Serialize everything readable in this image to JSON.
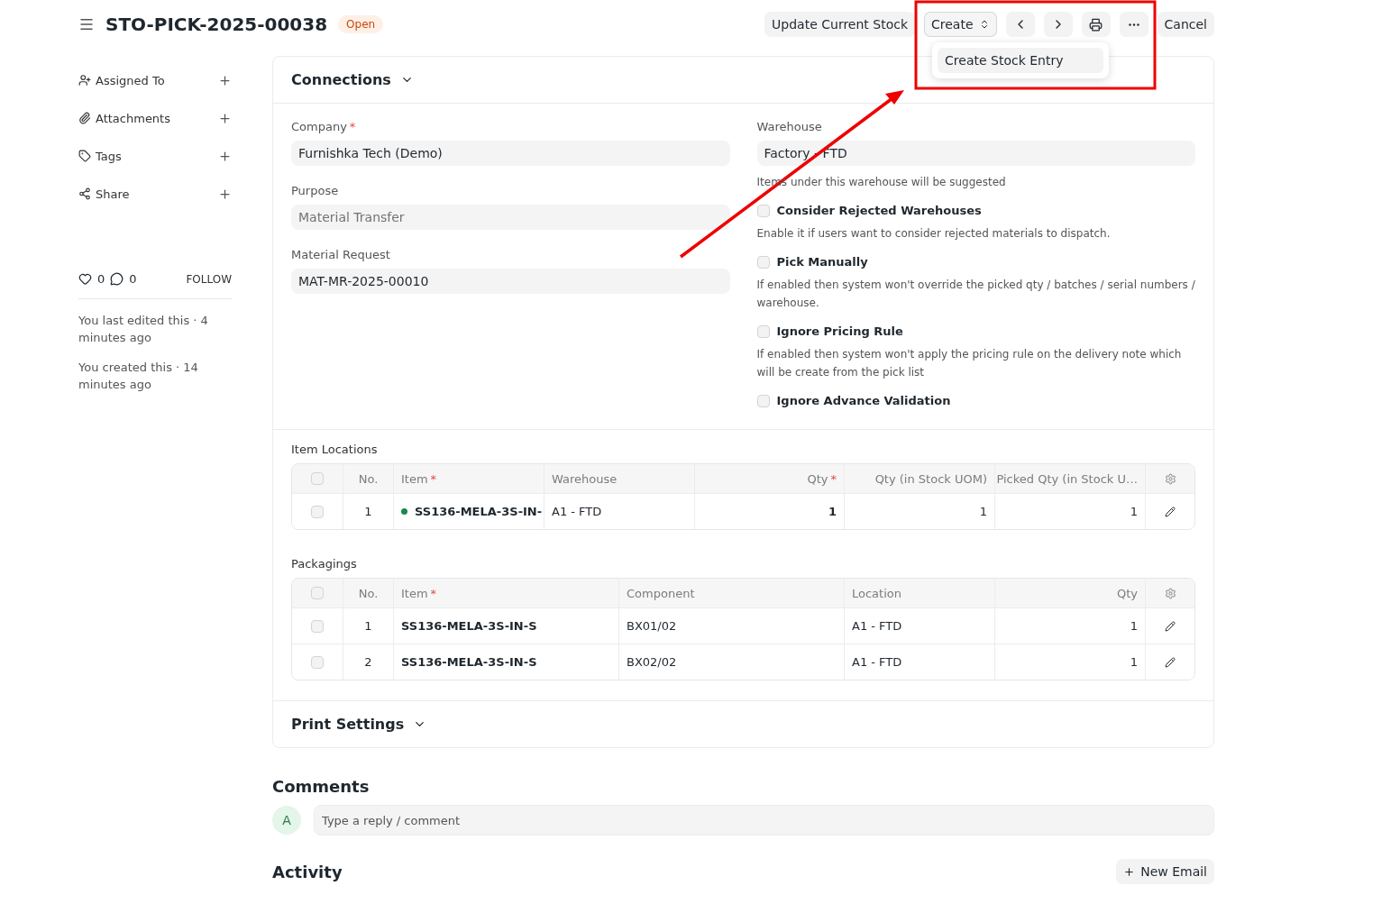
{
  "header": {
    "title": "STO-PICK-2025-00038",
    "status": "Open"
  },
  "actions": [
    {
      "kind": "text",
      "label": "Update Current Stock"
    },
    {
      "kind": "dropdown",
      "label": "Create"
    },
    {
      "kind": "prev"
    },
    {
      "kind": "next"
    },
    {
      "kind": "print"
    },
    {
      "kind": "more"
    },
    {
      "kind": "text",
      "label": "Cancel"
    }
  ],
  "dropdown": {
    "items": [
      "Create Stock Entry"
    ]
  },
  "sidebar": {
    "items": [
      {
        "kind": "assign",
        "label": "Assigned To"
      },
      {
        "kind": "attach",
        "label": "Attachments"
      },
      {
        "kind": "tag",
        "label": "Tags"
      },
      {
        "kind": "share",
        "label": "Share"
      }
    ],
    "likes": "0",
    "comments": "0",
    "follow": "FOLLOW",
    "timeline": [
      "You last edited this · 4 minutes ago",
      "You created this · 14 minutes ago"
    ]
  },
  "connections": "Connections",
  "left_fields": [
    {
      "label": "Company",
      "required_mark": "*",
      "value": "Furnishka Tech (Demo)",
      "readonly": false
    },
    {
      "label": "Purpose",
      "value": "Material Transfer",
      "readonly": true
    },
    {
      "label": "Material Request",
      "value": "MAT-MR-2025-00010",
      "readonly": false
    }
  ],
  "warehouse": {
    "label": "Warehouse",
    "value": "Factory - FTD",
    "description": "Items under this warehouse will be suggested"
  },
  "checks": [
    {
      "label": "Consider Rejected Warehouses",
      "checked": false,
      "description": "Enable it if users want to consider rejected materials to dispatch."
    },
    {
      "label": "Pick Manually",
      "checked": false,
      "description": "If enabled then system won't override the picked qty / batches / serial numbers / warehouse."
    },
    {
      "label": "Ignore Pricing Rule",
      "checked": false,
      "description": "If enabled then system won't apply the pricing rule on the delivery note which will be create from the pick list"
    },
    {
      "label": "Ignore Advance Validation",
      "checked": false
    }
  ],
  "tables": [
    {
      "title": "Item Locations",
      "select_all": false,
      "columns": [
        {
          "label": "No.",
          "kind": "index"
        },
        {
          "label": "Item",
          "required_mark": "*",
          "kind": "link"
        },
        {
          "label": "Warehouse",
          "kind": "text"
        },
        {
          "label": "Qty",
          "required_mark": "*",
          "kind": "bold_number"
        },
        {
          "label": "Qty (in Stock UOM)",
          "kind": "number"
        },
        {
          "label": "Picked Qty (in Stock U…",
          "kind": "number"
        }
      ],
      "rows": [
        {
          "checked": false,
          "color": "#178a4f",
          "cells": [
            "1",
            "SS136-MELA-3S-IN-",
            "A1 - FTD",
            "1",
            "1",
            "1"
          ]
        }
      ]
    },
    {
      "title": "Packagings",
      "select_all": false,
      "columns": [
        {
          "label": "No.",
          "kind": "index"
        },
        {
          "label": "Item",
          "required_mark": "*",
          "kind": "link"
        },
        {
          "label": "Component",
          "kind": "text"
        },
        {
          "label": "Location",
          "kind": "text"
        },
        {
          "label": "Qty",
          "kind": "number"
        }
      ],
      "rows": [
        {
          "checked": false,
          "cells": [
            "1",
            "SS136-MELA-3S-IN-S",
            "BX01/02",
            "A1 - FTD",
            "1"
          ]
        },
        {
          "checked": false,
          "cells": [
            "2",
            "SS136-MELA-3S-IN-S",
            "BX02/02",
            "A1 - FTD",
            "1"
          ]
        }
      ]
    }
  ],
  "print_settings": "Print Settings",
  "comments": {
    "title": "Comments",
    "avatar": "A",
    "placeholder": "Type a reply / comment"
  },
  "activity": {
    "title": "Activity",
    "button": "New Email"
  }
}
